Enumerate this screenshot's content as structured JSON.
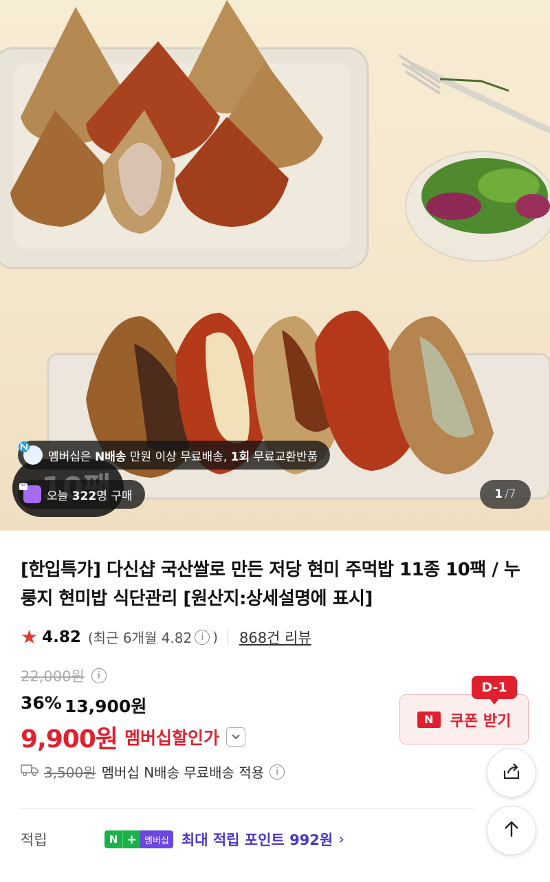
{
  "hero": {
    "member_banner": {
      "prefix": "멤버십은 ",
      "highlight": "N배송",
      "text": " 만원 이상 무료배송, ",
      "highlight2": "1회",
      "suffix": " 무료교환반품"
    },
    "today": {
      "prefix": "오늘 ",
      "count": "322",
      "suffix": "명 구매"
    },
    "badge_text": "10팩",
    "page_current": "1",
    "page_total": "/7"
  },
  "product": {
    "title": "[한입특가] 다신샵 국산쌀로 만든 저당 현미 주먹밥 11종 10팩 / 누룽지 현미밥 식단관리 [원산지:상세설명에 표시]",
    "rating": "4.82",
    "rating_recent_prefix": "(최근 6개월 4.82",
    "rating_recent_suffix": ")",
    "reviews": "868건 리뷰",
    "original_price": "22,000원",
    "discount_rate": "36%",
    "discount_price": "13,900원",
    "member_price": "9,900원",
    "member_price_label": "멤버십할인가",
    "coupon_label": "쿠폰 받기",
    "coupon_deadline": "D-1",
    "shipping_old": "3,500원",
    "shipping_text": "멤버십 N배송 무료배송 적용",
    "points_label": "적립",
    "points_badge": "멤버십",
    "points_text": "최대 적립 포인트 992원"
  },
  "colors": {
    "accent_red": "#e0202e",
    "points_purple": "#4a36c8",
    "npay_green": "#19b34a"
  },
  "icons": [
    "info-icon",
    "star-icon",
    "chevron-down-icon",
    "truck-icon",
    "share-icon",
    "arrow-up-icon",
    "chevron-right-icon",
    "naver-n-icon",
    "bag-icon"
  ]
}
